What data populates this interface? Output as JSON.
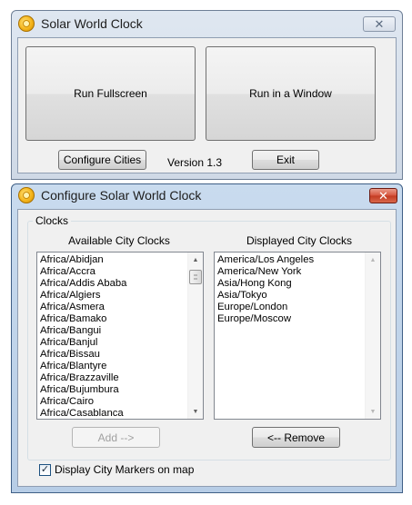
{
  "main_window": {
    "title": "Solar World Clock",
    "close_glyph": "✕",
    "run_fullscreen_label": "Run Fullscreen",
    "run_window_label": "Run in a Window",
    "configure_label": "Configure Cities",
    "version": "Version 1.3",
    "exit_label": "Exit"
  },
  "config_window": {
    "title": "Configure Solar World Clock",
    "close_glyph": "✕",
    "group_label": "Clocks",
    "available_label": "Available City Clocks",
    "displayed_label": "Displayed City Clocks",
    "available": [
      "Africa/Abidjan",
      "Africa/Accra",
      "Africa/Addis Ababa",
      "Africa/Algiers",
      "Africa/Asmera",
      "Africa/Bamako",
      "Africa/Bangui",
      "Africa/Banjul",
      "Africa/Bissau",
      "Africa/Blantyre",
      "Africa/Brazzaville",
      "Africa/Bujumbura",
      "Africa/Cairo",
      "Africa/Casablanca"
    ],
    "displayed": [
      "America/Los Angeles",
      "America/New York",
      "Asia/Hong Kong",
      "Asia/Tokyo",
      "Europe/London",
      "Europe/Moscow"
    ],
    "add_label": "Add -->",
    "remove_label": "<-- Remove",
    "markers_label": "Display City Markers on map",
    "markers_checked": true,
    "check_glyph": "✓"
  },
  "icons": {
    "app_icon": "sun-icon",
    "close_icon": "close-icon",
    "scroll_up": "scroll-up-arrow-icon",
    "scroll_down": "scroll-down-arrow-icon"
  }
}
